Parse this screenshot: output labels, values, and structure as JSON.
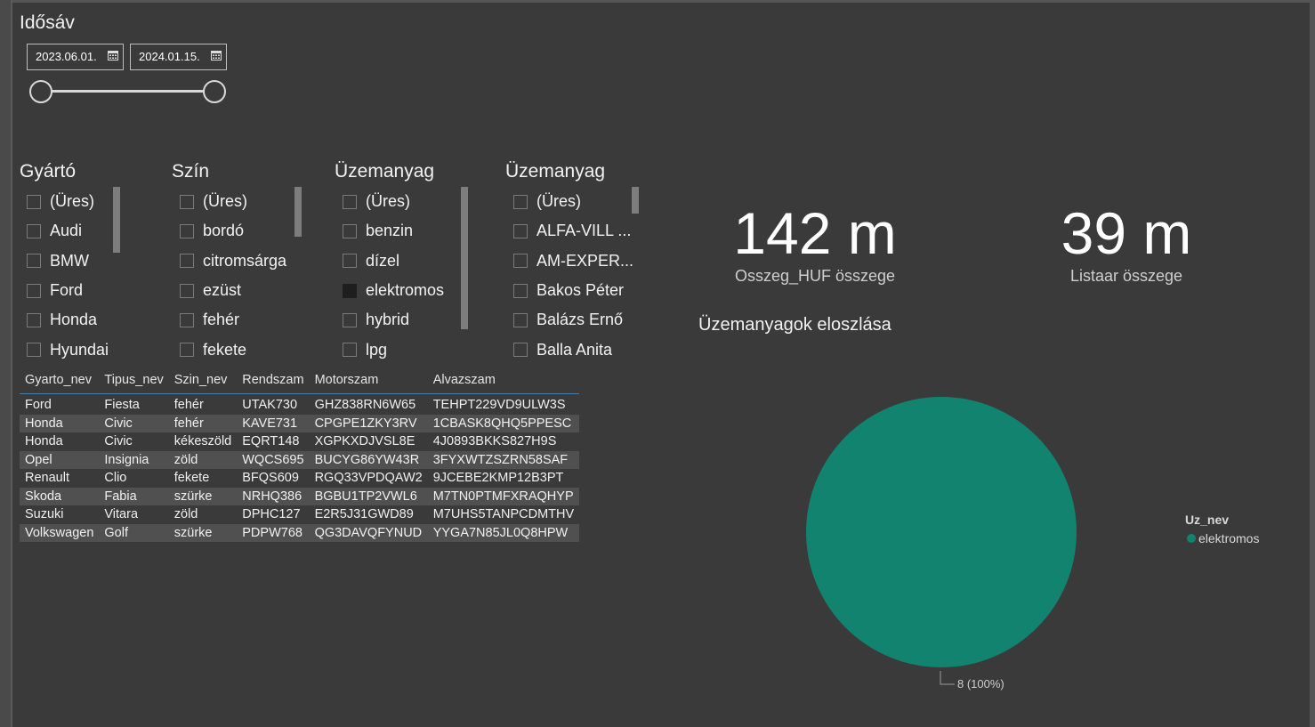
{
  "date_range": {
    "title": "Idősáv",
    "start": "2023.06.01.",
    "end": "2024.01.15."
  },
  "slicers": [
    {
      "title": "Gyártó",
      "items": [
        {
          "label": "(Üres)",
          "checked": false
        },
        {
          "label": "Audi",
          "checked": false
        },
        {
          "label": "BMW",
          "checked": false
        },
        {
          "label": "Ford",
          "checked": false
        },
        {
          "label": "Honda",
          "checked": false
        },
        {
          "label": "Hyundai",
          "checked": false
        }
      ]
    },
    {
      "title": "Szín",
      "items": [
        {
          "label": "(Üres)",
          "checked": false
        },
        {
          "label": "bordó",
          "checked": false
        },
        {
          "label": "citromsárga",
          "checked": false
        },
        {
          "label": "ezüst",
          "checked": false
        },
        {
          "label": "fehér",
          "checked": false
        },
        {
          "label": "fekete",
          "checked": false
        }
      ]
    },
    {
      "title": "Üzemanyag",
      "items": [
        {
          "label": "(Üres)",
          "checked": false
        },
        {
          "label": "benzin",
          "checked": false
        },
        {
          "label": "dízel",
          "checked": false
        },
        {
          "label": "elektromos",
          "checked": true
        },
        {
          "label": "hybrid",
          "checked": false
        },
        {
          "label": "lpg",
          "checked": false
        }
      ]
    },
    {
      "title": "Üzemanyag",
      "items": [
        {
          "label": "(Üres)",
          "checked": false
        },
        {
          "label": "ALFA-VILL ...",
          "checked": false
        },
        {
          "label": "AM-EXPER...",
          "checked": false
        },
        {
          "label": "Bakos Péter",
          "checked": false
        },
        {
          "label": "Balázs Ernő",
          "checked": false
        },
        {
          "label": "Balla Anita",
          "checked": false
        }
      ]
    }
  ],
  "table": {
    "columns": [
      "Gyarto_nev",
      "Tipus_nev",
      "Szin_nev",
      "Rendszam",
      "Motorszam",
      "Alvazszam"
    ],
    "rows": [
      [
        "Ford",
        "Fiesta",
        "fehér",
        "UTAK730",
        "GHZ838RN6W65",
        "TEHPT229VD9ULW3S"
      ],
      [
        "Honda",
        "Civic",
        "fehér",
        "KAVE731",
        "CPGPE1ZKY3RV",
        "1CBASK8QHQ5PPESC"
      ],
      [
        "Honda",
        "Civic",
        "kékeszöld",
        "EQRT148",
        "XGPKXDJVSL8E",
        "4J0893BKKS827H9S"
      ],
      [
        "Opel",
        "Insignia",
        "zöld",
        "WQCS695",
        "BUCYG86YW43R",
        "3FYXWTZSZRN58SAF"
      ],
      [
        "Renault",
        "Clio",
        "fekete",
        "BFQS609",
        "RGQ33VPDQAW2",
        "9JCEBE2KMP12B3PT"
      ],
      [
        "Skoda",
        "Fabia",
        "szürke",
        "NRHQ386",
        "BGBU1TP2VWL6",
        "M7TN0PTMFXRAQHYP"
      ],
      [
        "Suzuki",
        "Vitara",
        "zöld",
        "DPHC127",
        "E2R5J31GWD89",
        "M7UHS5TANPCDMTHV"
      ],
      [
        "Volkswagen",
        "Golf",
        "szürke",
        "PDPW768",
        "QG3DAVQFYNUD",
        "YYGA7N85JL0Q8HPW"
      ]
    ]
  },
  "kpis": [
    {
      "value": "142 m",
      "label": "Osszeg_HUF összege"
    },
    {
      "value": "39 m",
      "label": "Listaar összege"
    }
  ],
  "chart_data": {
    "type": "pie",
    "title": "Üzemanyagok eloszlása",
    "legend_title": "Uz_nev",
    "legend_position": "right",
    "slices": [
      {
        "label": "elektromos",
        "value": 8,
        "percent": 100,
        "color": "#12836f"
      }
    ],
    "data_label": "8 (100%)"
  }
}
